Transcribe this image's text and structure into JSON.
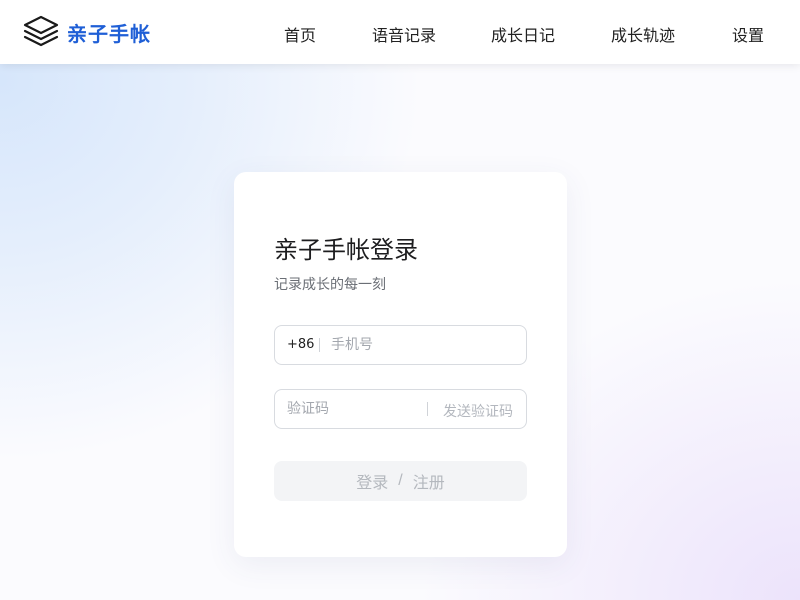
{
  "header": {
    "logo_text": "亲子手帐",
    "logo_icon": "layers-icon",
    "nav": [
      {
        "label": "首页"
      },
      {
        "label": "语音记录"
      },
      {
        "label": "成长日记"
      },
      {
        "label": "成长轨迹"
      },
      {
        "label": "设置"
      }
    ]
  },
  "login": {
    "title": "亲子手帐登录",
    "subtitle": "记录成长的每一刻",
    "phone_prefix": "+86",
    "phone_placeholder": "手机号",
    "phone_value": "",
    "code_placeholder": "验证码",
    "code_value": "",
    "send_code_label": "发送验证码",
    "submit_login_label": "登录",
    "submit_divider": "/",
    "submit_register_label": "注册"
  },
  "colors": {
    "brand": "#1f5fd6",
    "text": "#222222",
    "muted": "#6b6f76",
    "placeholder": "#a3a7ae",
    "button_bg": "#f3f4f6",
    "button_text": "#b4b8be"
  }
}
